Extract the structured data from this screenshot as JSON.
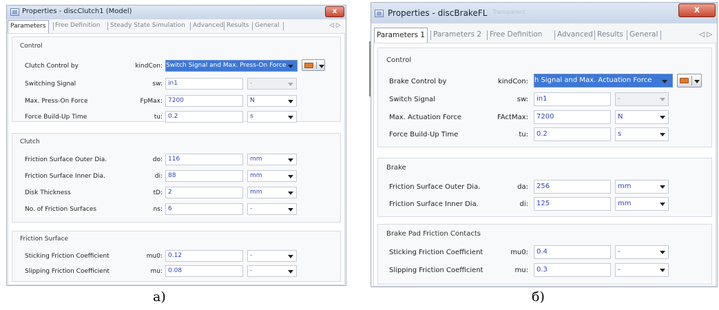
{
  "windows": [
    {
      "title": "Properties - discClutch1 (Model)",
      "close": "x",
      "tabs": [
        "Parameters",
        "Free Definition",
        "Steady State Simulation",
        "Advanced",
        "Results",
        "General"
      ],
      "tab_arrows": "◁ ▷",
      "groups": [
        {
          "title": "Control",
          "rows": [
            {
              "label": "Clutch Control by",
              "key": "kindCon:",
              "value": "Switch Signal and Max. Press-On Force"
            },
            {
              "label": "Switching Signal",
              "key": "sw:",
              "value": "in1",
              "unit": "-"
            },
            {
              "label": "Max. Press-On Force",
              "key": "FpMax:",
              "value": "7200",
              "unit": "N"
            },
            {
              "label": "Force Build-Up Time",
              "key": "tu:",
              "value": "0.2",
              "unit": "s"
            }
          ]
        },
        {
          "title": "Clutch",
          "rows": [
            {
              "label": "Friction Surface Outer Dia.",
              "key": "do:",
              "value": "116",
              "unit": "mm"
            },
            {
              "label": "Friction Surface Inner Dia.",
              "key": "di:",
              "value": "88",
              "unit": "mm"
            },
            {
              "label": "Disk Thickness",
              "key": "tD:",
              "value": "2",
              "unit": "mm"
            },
            {
              "label": "No. of Friction Surfaces",
              "key": "ns:",
              "value": "6",
              "unit": "-"
            }
          ]
        },
        {
          "title": "Friction Surface",
          "rows": [
            {
              "label": "Sticking Friction Coefficient",
              "key": "mu0:",
              "value": "0.12",
              "unit": "-"
            },
            {
              "label": "Slipping Friction Coefficient",
              "key": "mu:",
              "value": "0.08",
              "unit": "-"
            }
          ]
        }
      ],
      "caption": "а)"
    },
    {
      "title": "Properties - discBrakeFL",
      "close": "x",
      "ghost_text": "Transparent",
      "tabs": [
        "Parameters 1",
        "Parameters 2",
        "Free Definition",
        "Advanced",
        "Results",
        "General"
      ],
      "tab_arrows": "◁ ▷",
      "groups": [
        {
          "title": "Control",
          "rows": [
            {
              "label": "Brake Control by",
              "key": "kindCon:",
              "value": "h Signal and Max. Actuation Force"
            },
            {
              "label": "Switch Signal",
              "key": "sw:",
              "value": "in1",
              "unit": "-"
            },
            {
              "label": "Max. Actuation Force",
              "key": "FActMax:",
              "value": "7200",
              "unit": "N"
            },
            {
              "label": "Force Build-Up Time",
              "key": "tu:",
              "value": "0.2",
              "unit": "s"
            }
          ]
        },
        {
          "title": "Brake",
          "rows": [
            {
              "label": "Friction Surface Outer Dia.",
              "key": "da:",
              "value": "256",
              "unit": "mm"
            },
            {
              "label": "Friction Surface Inner Dia.",
              "key": "di:",
              "value": "125",
              "unit": "mm"
            }
          ]
        },
        {
          "title": "Brake Pad Friction Contacts",
          "rows": [
            {
              "label": "Sticking Friction Coefficient",
              "key": "mu0:",
              "value": "0.4",
              "unit": "-"
            },
            {
              "label": "Slipping Friction Coefficient",
              "key": "mu:",
              "value": "0.3",
              "unit": "-"
            }
          ]
        }
      ],
      "caption": "б)"
    }
  ]
}
